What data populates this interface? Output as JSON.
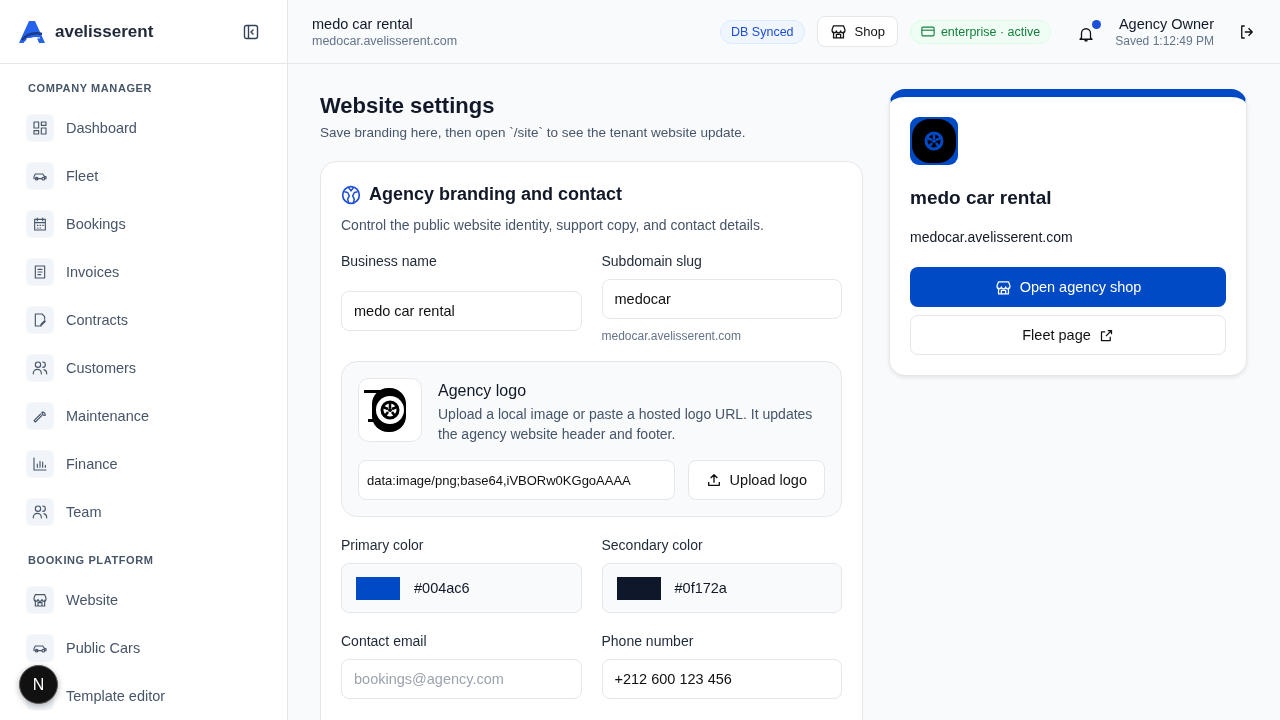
{
  "brand": {
    "name": "avelisserent"
  },
  "sidebar": {
    "sections": [
      {
        "title": "COMPANY MANAGER",
        "items": [
          {
            "label": "Dashboard"
          },
          {
            "label": "Fleet"
          },
          {
            "label": "Bookings"
          },
          {
            "label": "Invoices"
          },
          {
            "label": "Contracts"
          },
          {
            "label": "Customers"
          },
          {
            "label": "Maintenance"
          },
          {
            "label": "Finance"
          },
          {
            "label": "Team"
          }
        ]
      },
      {
        "title": "BOOKING PLATFORM",
        "items": [
          {
            "label": "Website"
          },
          {
            "label": "Public Cars"
          },
          {
            "label": "Template editor"
          }
        ]
      }
    ]
  },
  "dev_badge": "N",
  "header": {
    "tenant_name": "medo car rental",
    "tenant_domain": "medocar.avelisserent.com",
    "sync_badge": "DB Synced",
    "shop_button": "Shop",
    "plan_badge": "enterprise · active",
    "notification_dot": true,
    "user_name": "Agency Owner",
    "saved_status": "Saved 1:12:49 PM"
  },
  "page": {
    "title": "Website settings",
    "subtitle": "Save branding here, then open `/site` to see the tenant website update."
  },
  "form": {
    "title": "Agency branding and contact",
    "description": "Control the public website identity, support copy, and contact details.",
    "business_name": {
      "label": "Business name",
      "value": "medo car rental"
    },
    "subdomain": {
      "label": "Subdomain slug",
      "value": "medocar",
      "hint": "medocar.avelisserent.com"
    },
    "logo": {
      "title": "Agency logo",
      "description": "Upload a local image or paste a hosted logo URL. It updates the agency website header and footer.",
      "url_value": "data:image/png;base64,iVBORw0KGgoAAAA",
      "upload_button": "Upload logo"
    },
    "primary_color": {
      "label": "Primary color",
      "value": "#004ac6"
    },
    "secondary_color": {
      "label": "Secondary color",
      "value": "#0f172a"
    },
    "contact_email": {
      "label": "Contact email",
      "placeholder": "bookings@agency.com"
    },
    "phone": {
      "label": "Phone number",
      "value": "+212 600 123 456"
    }
  },
  "preview": {
    "name": "medo car rental",
    "domain": "medocar.avelisserent.com",
    "primary_button": "Open agency shop",
    "secondary_button": "Fleet page"
  }
}
